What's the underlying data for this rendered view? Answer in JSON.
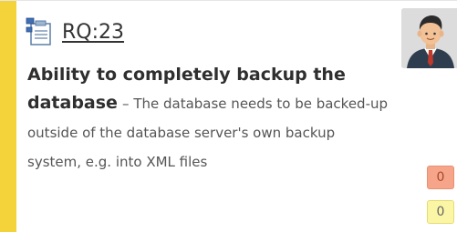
{
  "requirement": {
    "id": "RQ:23",
    "title": "Ability to completely backup the database",
    "separator": "–",
    "description": "The database needs to be backed-up outside of the database server's own backup system, e.g. into XML files",
    "icon": "requirement-tree-icon"
  },
  "owner": {
    "avatar": "user-avatar"
  },
  "badges": {
    "first": "0",
    "second": "0"
  },
  "colors": {
    "accent": "#f3d23a",
    "badge_red": "#f6a58a",
    "badge_yellow": "#fbf6a6"
  }
}
